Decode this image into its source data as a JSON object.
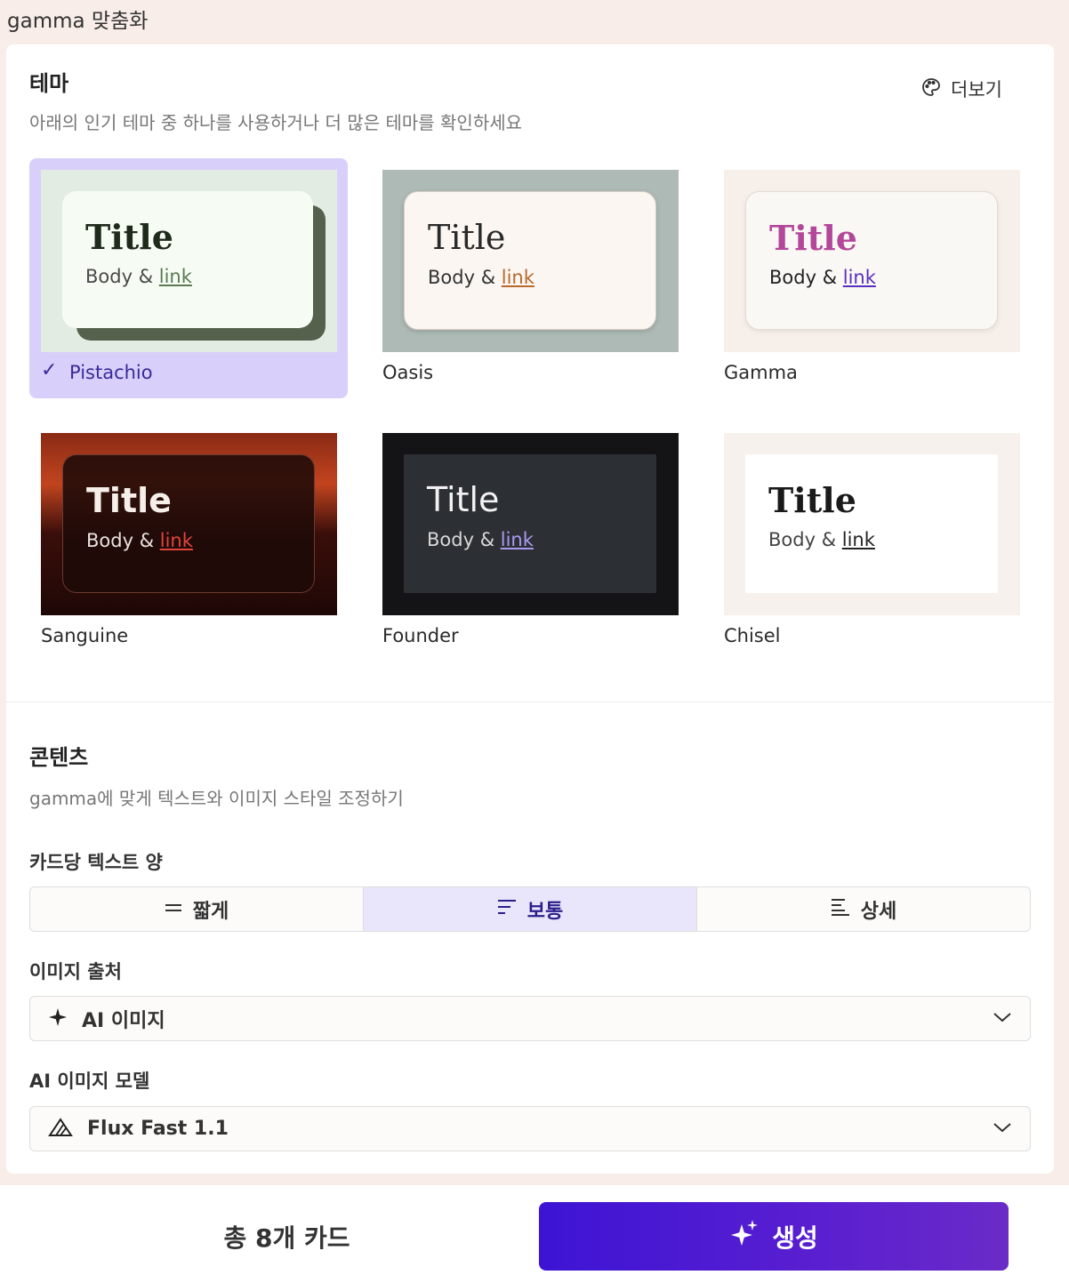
{
  "header": {
    "title": "gamma 맞춤화"
  },
  "theme_section": {
    "title": "테마",
    "description": "아래의 인기 테마 중 하나를 사용하거나 더 많은 테마를 확인하세요",
    "more_label": "더보기",
    "preview_title": "Title",
    "preview_body": "Body & ",
    "preview_link": "link",
    "themes": [
      {
        "name": "Pistachio",
        "selected": true
      },
      {
        "name": "Oasis",
        "selected": false
      },
      {
        "name": "Gamma",
        "selected": false
      },
      {
        "name": "Sanguine",
        "selected": false
      },
      {
        "name": "Founder",
        "selected": false
      },
      {
        "name": "Chisel",
        "selected": false
      }
    ]
  },
  "content_section": {
    "title": "콘텐츠",
    "description": "gamma에 맞게 텍스트와 이미지 스타일 조정하기",
    "text_amount_label": "카드당 텍스트 양",
    "text_amount_options": [
      {
        "label": "짧게",
        "icon": "short-lines-icon",
        "active": false
      },
      {
        "label": "보통",
        "icon": "medium-lines-icon",
        "active": true
      },
      {
        "label": "상세",
        "icon": "detailed-lines-icon",
        "active": false
      }
    ],
    "image_source_label": "이미지 출처",
    "image_source_value": "AI 이미지",
    "image_model_label": "AI 이미지 모델",
    "image_model_value": "Flux Fast 1.1"
  },
  "footer": {
    "card_count": "총 8개 카드",
    "generate_label": "생성"
  },
  "colors": {
    "accent": "#3d14d4",
    "selected_bg": "#d8d0fa",
    "active_segment": "#e9e6fb"
  }
}
